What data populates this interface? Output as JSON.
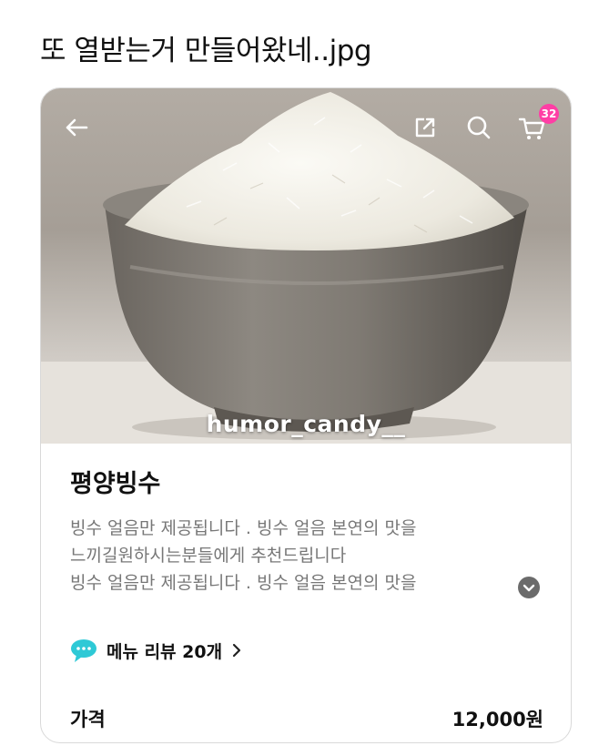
{
  "post": {
    "title": "또 열받는거 만들어왔네..jpg"
  },
  "header": {
    "cart_count": "32",
    "icons": [
      "back-arrow-icon",
      "share-icon",
      "search-icon",
      "cart-icon"
    ]
  },
  "image": {
    "watermark": "humor_candy__"
  },
  "menu": {
    "name": "평양빙수",
    "description_lines": [
      "빙수 얼음만 제공됩니다 . 빙수 얼음 본연의 맛을",
      "느끼길원하시는분들에게 추천드립니다",
      "빙수 얼음만 제공됩니다 . 빙수 얼음 본연의 맛을"
    ],
    "review_label": "메뉴 리뷰 20개"
  },
  "price": {
    "label": "가격",
    "value": "12,000원"
  },
  "colors": {
    "badge": "#ff3ea5",
    "review_bubble": "#2ec9d6",
    "description": "#777777"
  }
}
